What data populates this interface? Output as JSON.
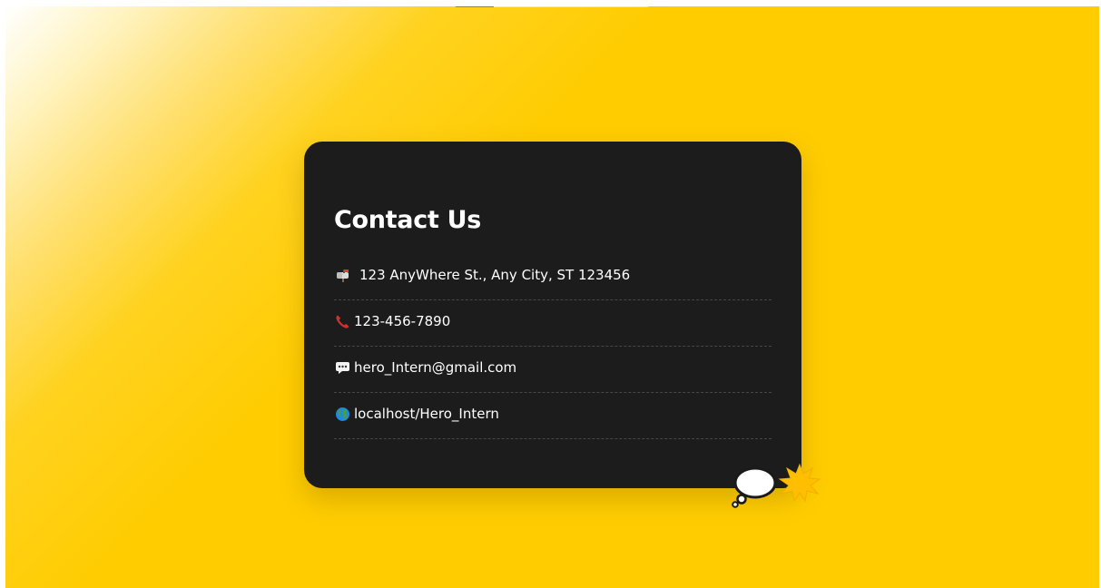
{
  "contact": {
    "title": "Contact Us",
    "items": [
      {
        "icon": "mailbox-icon",
        "text": "123 AnyWhere St., Any City, ST 123456"
      },
      {
        "icon": "phone-icon",
        "text": "123-456-7890"
      },
      {
        "icon": "speech-balloon-icon",
        "text": "hero_Intern@gmail.com"
      },
      {
        "icon": "globe-icon",
        "text": "localhost/Hero_Intern"
      }
    ]
  },
  "colors": {
    "background_accent": "#ffcc00",
    "card_background": "#1c1c1c",
    "text": "#ffffff",
    "divider": "#474747"
  }
}
